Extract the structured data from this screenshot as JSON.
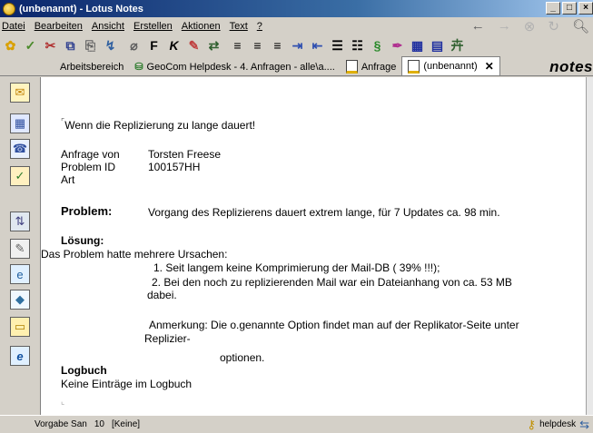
{
  "window": {
    "title": "(unbenannt) - Lotus Notes",
    "buttons": [
      "_",
      "□",
      "×"
    ]
  },
  "menu": [
    "Datei",
    "Bearbeiten",
    "Ansicht",
    "Erstellen",
    "Aktionen",
    "Text",
    "?"
  ],
  "tabs": {
    "workspace": "Arbeitsbereich",
    "helpdesk": "GeoCom Helpdesk - 4. Anfragen - alle\\a....",
    "anfrage": "Anfrage",
    "current": "(unbenannt)"
  },
  "brand": "notes",
  "document": {
    "subject": "Wenn die Replizierung zu lange dauert!",
    "fields": [
      {
        "label": "Anfrage von",
        "value": "Torsten Freese"
      },
      {
        "label": "Problem ID",
        "value": "100157HH"
      },
      {
        "label": "Art",
        "value": ""
      }
    ],
    "problem_label": "Problem:",
    "problem_text": "Vorgang des Replizierens dauert extrem lange, für 7 Updates ca. 98 min.",
    "solution_label": "Lösung:",
    "solution_intro": "Das Problem hatte mehrere Ursachen:",
    "cause1": "1. Seit langem keine Komprimierung der Mail-DB ( 39% !!!);",
    "cause2a": "2. Bei den noch zu replizierenden Mail war ein Dateianhang von ca. 53 MB",
    "cause2b": "dabei.",
    "note_a": "Anmerkung: Die o.genannte Option findet man auf der Replikator-Seite unter",
    "note_b": "Replizier-",
    "note_c": "optionen.",
    "log_label": "Logbuch",
    "log_text": "Keine Einträge im Logbuch"
  },
  "status": {
    "font": "Vorgabe San",
    "size": "10",
    "style": "[Keine]",
    "location": "helpdesk"
  }
}
